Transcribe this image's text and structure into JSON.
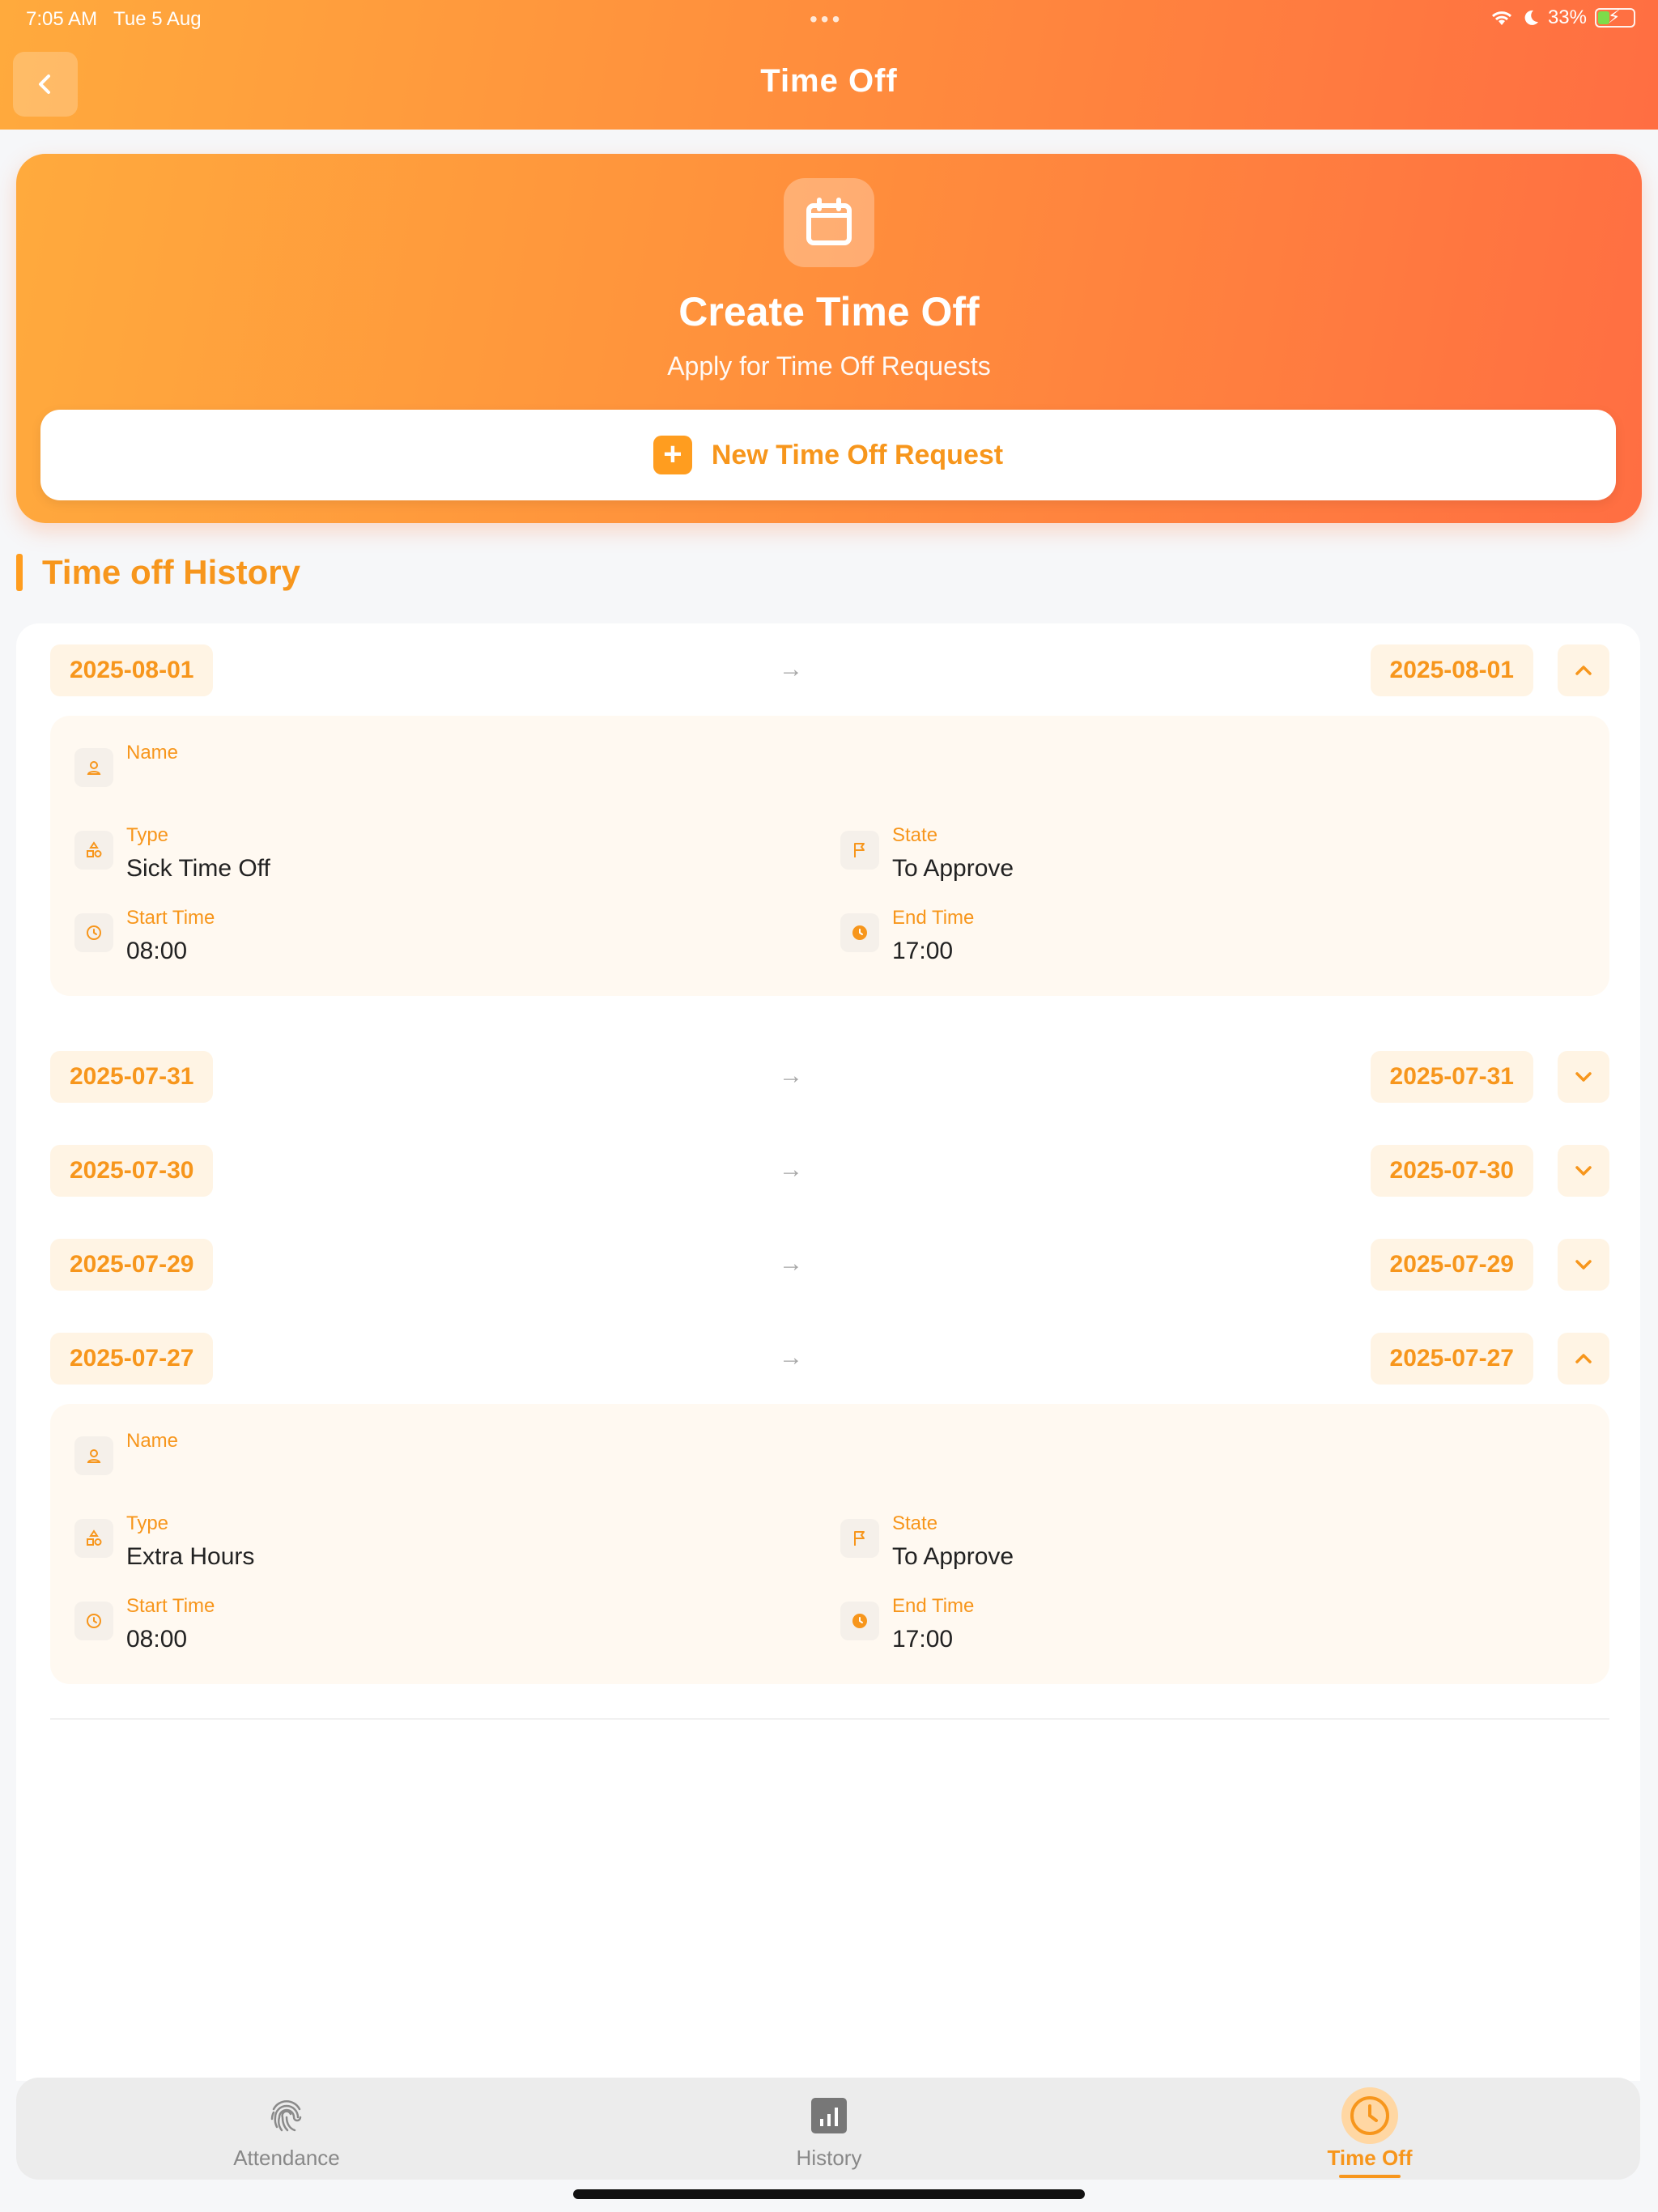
{
  "status_bar": {
    "time": "7:05 AM",
    "date": "Tue 5 Aug",
    "battery": "33%",
    "dots": "•••"
  },
  "header": {
    "title": "Time Off",
    "back_icon": "chevron-left-icon"
  },
  "create": {
    "title": "Create Time Off",
    "subtitle": "Apply for Time Off Requests",
    "button_label": "New Time Off Request",
    "plus": "+",
    "calendar_icon": "calendar-icon"
  },
  "history": {
    "title": "Time off History",
    "arrow": "→",
    "labels": {
      "name": "Name",
      "type": "Type",
      "state": "State",
      "start": "Start Time",
      "end": "End Time"
    },
    "entries": [
      {
        "start_date": "2025-08-01",
        "end_date": "2025-08-01",
        "expanded": true,
        "name": "",
        "type": "Sick Time Off",
        "state": "To Approve",
        "start_time": "08:00",
        "end_time": "17:00"
      },
      {
        "start_date": "2025-07-31",
        "end_date": "2025-07-31",
        "expanded": false
      },
      {
        "start_date": "2025-07-30",
        "end_date": "2025-07-30",
        "expanded": false
      },
      {
        "start_date": "2025-07-29",
        "end_date": "2025-07-29",
        "expanded": false
      },
      {
        "start_date": "2025-07-27",
        "end_date": "2025-07-27",
        "expanded": true,
        "name": "",
        "type": "Extra Hours",
        "state": "To Approve",
        "start_time": "08:00",
        "end_time": "17:00"
      }
    ]
  },
  "nav": {
    "items": [
      {
        "label": "Attendance",
        "icon": "fingerprint-icon",
        "active": false
      },
      {
        "label": "History",
        "icon": "bar-chart-icon",
        "active": false
      },
      {
        "label": "Time Off",
        "icon": "clock-icon",
        "active": true
      }
    ]
  },
  "colors": {
    "accent": "#f7961c",
    "gradient_start": "#ffaa3d",
    "gradient_end": "#ff6e42",
    "pill_bg": "#fff4e4",
    "card_bg": "#fff9f1"
  }
}
